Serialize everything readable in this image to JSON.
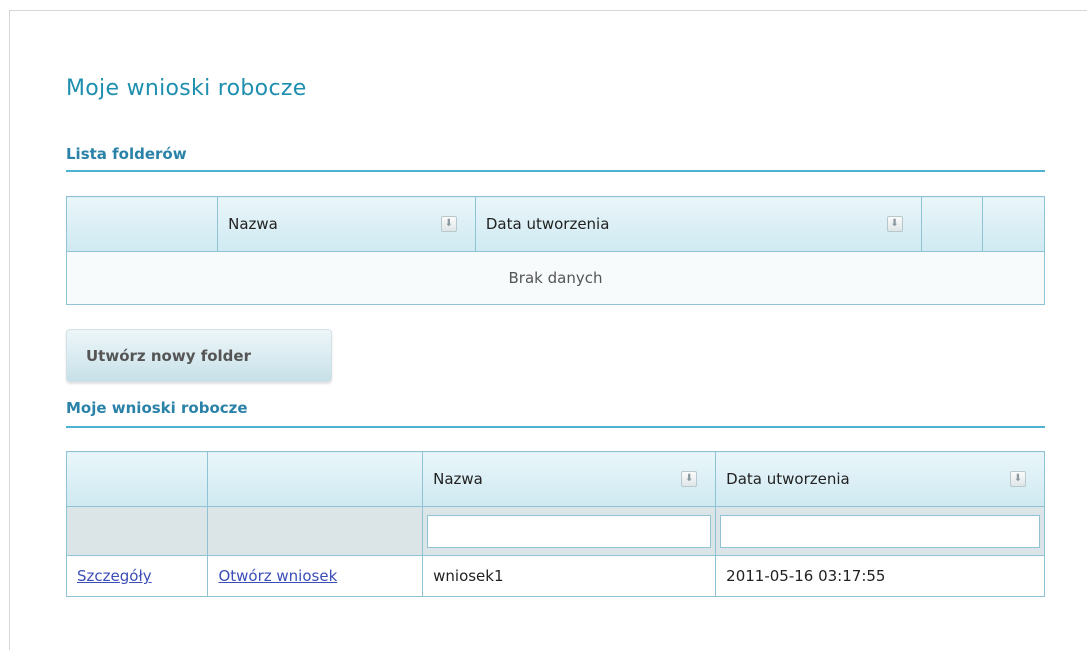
{
  "page_title": "Moje wnioski robocze",
  "folders": {
    "section_title": "Lista folderów",
    "columns": [
      "",
      "Nazwa",
      "Data utworzenia",
      "",
      ""
    ],
    "empty_text": "Brak danych"
  },
  "create_folder_button": "Utwórz nowy folder",
  "drafts": {
    "section_title": "Moje wnioski robocze",
    "columns": [
      "",
      "",
      "Nazwa",
      "Data utworzenia"
    ],
    "filters": {
      "name_value": "",
      "date_value": ""
    },
    "rows": [
      {
        "details_link": "Szczegóły",
        "open_link": "Otwórz wniosek",
        "name": "wniosek1",
        "created": "2011-05-16 03:17:55"
      }
    ]
  },
  "icons": {
    "sort": "sort-down-icon"
  },
  "colors": {
    "accent": "#1f8fb0",
    "section_line": "#4fb0cf",
    "grid_border": "#8fc2d4",
    "link": "#3b4db8"
  }
}
